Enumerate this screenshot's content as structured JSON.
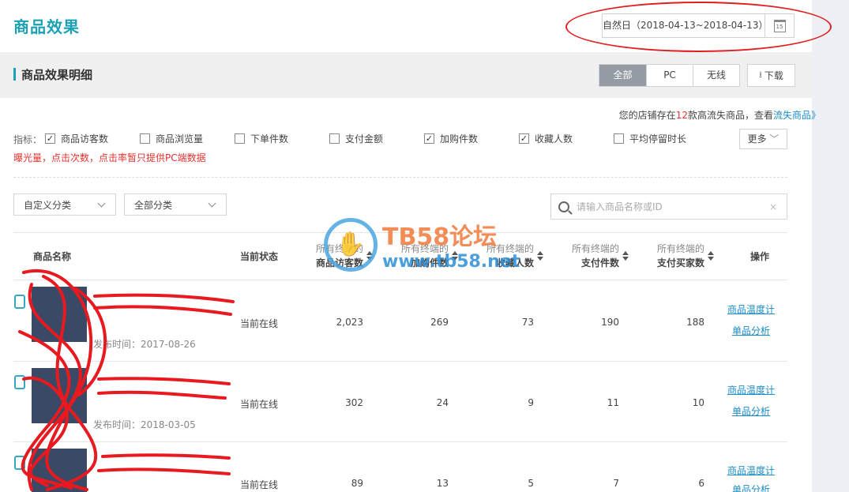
{
  "page": {
    "title": "商品效果"
  },
  "date_range": {
    "label": "自然日（2018-04-13~2018-04-13）",
    "calendar_day": "15"
  },
  "section": {
    "title": "商品效果明细",
    "tabs": [
      {
        "label": "全部",
        "active": true
      },
      {
        "label": "PC",
        "active": false
      },
      {
        "label": "无线",
        "active": false
      }
    ],
    "download_label": "下载"
  },
  "notice": {
    "prefix": "您的店铺存在",
    "count": "12",
    "middle": "款高流失商品，查看",
    "link": "流失商品》"
  },
  "metrics": {
    "label": "指标：",
    "items": [
      {
        "label": "商品访客数",
        "checked": true
      },
      {
        "label": "商品浏览量",
        "checked": false
      },
      {
        "label": "下单件数",
        "checked": false
      },
      {
        "label": "支付金额",
        "checked": false
      },
      {
        "label": "加购件数",
        "checked": true
      },
      {
        "label": "收藏人数",
        "checked": true
      },
      {
        "label": "平均停留时长",
        "checked": false
      }
    ],
    "more_label": "更多",
    "warning": "曝光量，点击次数，点击率暂只提供PC端数据"
  },
  "filters": {
    "custom_category": "自定义分类",
    "all_category": "全部分类",
    "search_placeholder": "请输入商品名称或ID"
  },
  "table": {
    "headers": {
      "name": "商品名称",
      "status": "当前状态",
      "col1": {
        "l1": "所有终端的",
        "l2": "商品访客数"
      },
      "col2": {
        "l1": "所有终端的",
        "l2": "加购件数"
      },
      "col3": {
        "l1": "所有终端的",
        "l2": "收藏人数"
      },
      "col4": {
        "l1": "所有终端的",
        "l2": "支付件数"
      },
      "col5": {
        "l1": "所有终端的",
        "l2": "支付买家数"
      },
      "ops": "操作"
    },
    "rows": [
      {
        "pub": "发布时间：2017-08-26",
        "status": "当前在线",
        "v1": "2,023",
        "v2": "269",
        "v3": "73",
        "v4": "190",
        "v5": "188",
        "op1": "商品温度计",
        "op2": "单品分析"
      },
      {
        "pub": "发布时间：2018-03-05",
        "status": "当前在线",
        "v1": "302",
        "v2": "24",
        "v3": "9",
        "v4": "11",
        "v5": "10",
        "op1": "商品温度计",
        "op2": "单品分析"
      },
      {
        "pub": "",
        "status": "当前在线",
        "v1": "89",
        "v2": "13",
        "v3": "5",
        "v4": "7",
        "v5": "6",
        "op1": "商品温度计",
        "op2": "单品分析"
      }
    ]
  },
  "watermark": {
    "line1": "TB58论坛",
    "line2": "www.tb58.net"
  },
  "colors": {
    "accent": "#1aa1b5",
    "link": "#1a8cc7",
    "warning": "#e5322d",
    "annotation": "#e02020"
  }
}
